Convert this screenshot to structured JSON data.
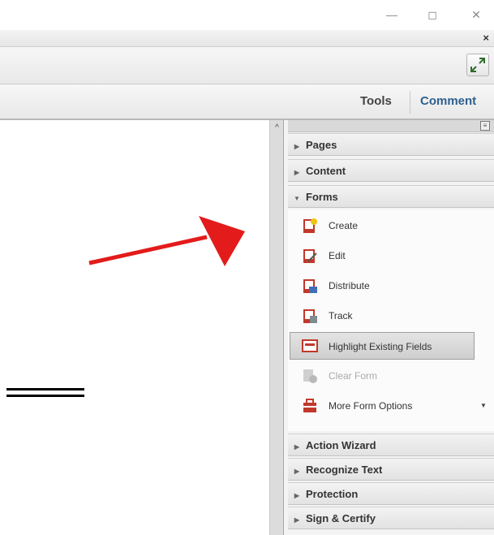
{
  "window": {
    "minimize": "—",
    "restore": "◻",
    "close": "✕",
    "doc_close": "×",
    "expand_icon": "expand-icon"
  },
  "toolbar": {
    "tools_label": "Tools",
    "comment_label": "Comment"
  },
  "panel": {
    "menu_icon": "panel-menu-icon",
    "sections_top": [
      {
        "label": "Pages",
        "state": "collapsed"
      },
      {
        "label": "Content",
        "state": "collapsed"
      },
      {
        "label": "Forms",
        "state": "expanded"
      }
    ],
    "forms_items": [
      {
        "label": "Create",
        "icon": "create-form-icon"
      },
      {
        "label": "Edit",
        "icon": "edit-form-icon"
      },
      {
        "label": "Distribute",
        "icon": "distribute-form-icon"
      },
      {
        "label": "Track",
        "icon": "track-form-icon"
      },
      {
        "label": "Highlight Existing Fields",
        "icon": "highlight-fields-icon",
        "selected": true
      },
      {
        "label": "Clear Form",
        "icon": "clear-form-icon",
        "disabled": true
      },
      {
        "label": "More Form Options",
        "icon": "more-form-options-icon",
        "dropdown": true
      }
    ],
    "sections_bottom": [
      {
        "label": "Action Wizard"
      },
      {
        "label": "Recognize Text"
      },
      {
        "label": "Protection"
      },
      {
        "label": "Sign & Certify"
      }
    ]
  },
  "colors": {
    "arrow": "#e31b1b",
    "comment_tab": "#2e5f8f"
  }
}
